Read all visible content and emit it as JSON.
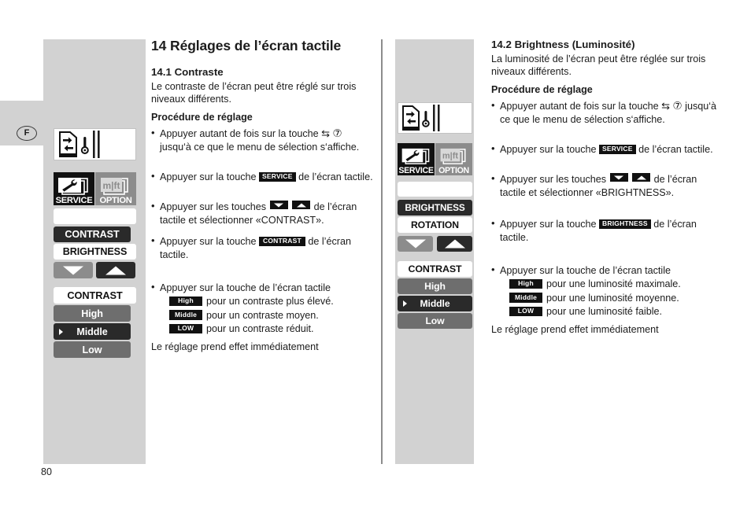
{
  "page": {
    "number": "80",
    "language_marker": "F"
  },
  "left_column": {
    "main_title": "14 Réglages de l’écran tactile",
    "section_number_title": "14.1 Contraste",
    "intro": "Le contraste de l’écran peut être réglé sur trois niveaux différents.",
    "procedure_heading": "Procédure de réglage",
    "steps": [
      {
        "text_before": "Appuyer autant de fois sur la touche ",
        "symbol": "⇆",
        "circled_number": "⑦",
        "text_after": " jusqu‘à ce que le menu de sélection s‘affiche."
      },
      {
        "text_before": "Appuyer sur la touche ",
        "badge": "SERVICE",
        "text_after": " de l’écran tactile."
      },
      {
        "text_before": "Appuyer sur les touches ",
        "text_after": " de l’écran tactile et sélectionner «CONTRAST»."
      },
      {
        "text_before": "Appuyer sur la touche ",
        "badge": "CONTRAST",
        "text_after": " de l’écran tactile."
      },
      {
        "text_before": "Appuyer sur la touche de l’écran tactile",
        "levels": [
          {
            "badge": "High",
            "text": "pour un contraste plus élevé."
          },
          {
            "badge": "Middle",
            "text": "pour un contraste moyen."
          },
          {
            "badge": "LOW",
            "text": "pour un contraste réduit."
          }
        ]
      }
    ],
    "closing": "Le réglage prend effet immédiatement"
  },
  "right_column": {
    "section_number_title": "14.2 Brightness (Luminosité)",
    "intro": "La luminosité de l’écran peut être réglée sur trois niveaux différents.",
    "procedure_heading": "Procédure de réglage",
    "steps": [
      {
        "text_before": "Appuyer autant de fois sur la touche ",
        "symbol": "⇆",
        "circled_number": "⑦",
        "text_after": " jusqu‘à ce que le menu de sélection s‘affiche."
      },
      {
        "text_before": "Appuyer sur la touche ",
        "badge": "SERVICE",
        "text_after": " de l’écran tactile."
      },
      {
        "text_before": "Appuyer sur les touches ",
        "text_after": " de l’écran tactile et sélectionner «BRIGHTNESS»."
      },
      {
        "text_before": "Appuyer sur la touche  ",
        "badge": "BRIGHTNESS",
        "text_after": " de l’écran tactile."
      },
      {
        "text_before": "Appuyer sur la touche de l’écran tactile",
        "levels": [
          {
            "badge": "High",
            "text": "pour une luminosité maximale."
          },
          {
            "badge": "Middle",
            "text": "pour une luminosité moyenne."
          },
          {
            "badge": "LOW",
            "text": "pour une luminosité faible."
          }
        ]
      }
    ],
    "closing": "Le réglage prend effet immédiatement"
  },
  "left_panel": {
    "tiles": [
      {
        "label": "SERVICE",
        "icon": "wrench-stack-icon",
        "state": "selected"
      },
      {
        "label": "OPTION",
        "icon": "mft-stack-icon",
        "state": "normal"
      }
    ],
    "menu_top": [
      {
        "label": "CONTRAST",
        "state": "selected"
      },
      {
        "label": "BRIGHTNESS",
        "state": "normal"
      }
    ],
    "arrow_buttons": [
      {
        "icon": "arrow-down-icon",
        "state": "normal"
      },
      {
        "icon": "arrow-up-icon",
        "state": "selected"
      }
    ],
    "menu_bottom": {
      "header": "CONTRAST",
      "items": [
        {
          "label": "High",
          "state": "normal",
          "marked": false
        },
        {
          "label": "Middle",
          "state": "selected",
          "marked": true
        },
        {
          "label": "Low",
          "state": "normal",
          "marked": false
        }
      ]
    }
  },
  "right_panel": {
    "tiles": [
      {
        "label": "SERVICE",
        "icon": "wrench-stack-icon",
        "state": "selected"
      },
      {
        "label": "OPTION",
        "icon": "mft-stack-icon",
        "state": "normal"
      }
    ],
    "menu_top": [
      {
        "label": "BRIGHTNESS",
        "state": "selected"
      },
      {
        "label": "ROTATION",
        "state": "normal"
      }
    ],
    "arrow_buttons": [
      {
        "icon": "arrow-down-icon",
        "state": "normal"
      },
      {
        "icon": "arrow-up-icon",
        "state": "selected"
      }
    ],
    "menu_bottom": {
      "header": "CONTRAST",
      "items": [
        {
          "label": "High",
          "state": "normal",
          "marked": false
        },
        {
          "label": "Middle",
          "state": "selected",
          "marked": true
        },
        {
          "label": "Low",
          "state": "normal",
          "marked": false
        }
      ]
    }
  },
  "colors": {
    "panel_bg": "#d2d2d2",
    "selected": "#2a2a2a",
    "normal": "#6e6e6e",
    "white_row": "#ffffff",
    "tile_option": "#8c8c8c"
  }
}
